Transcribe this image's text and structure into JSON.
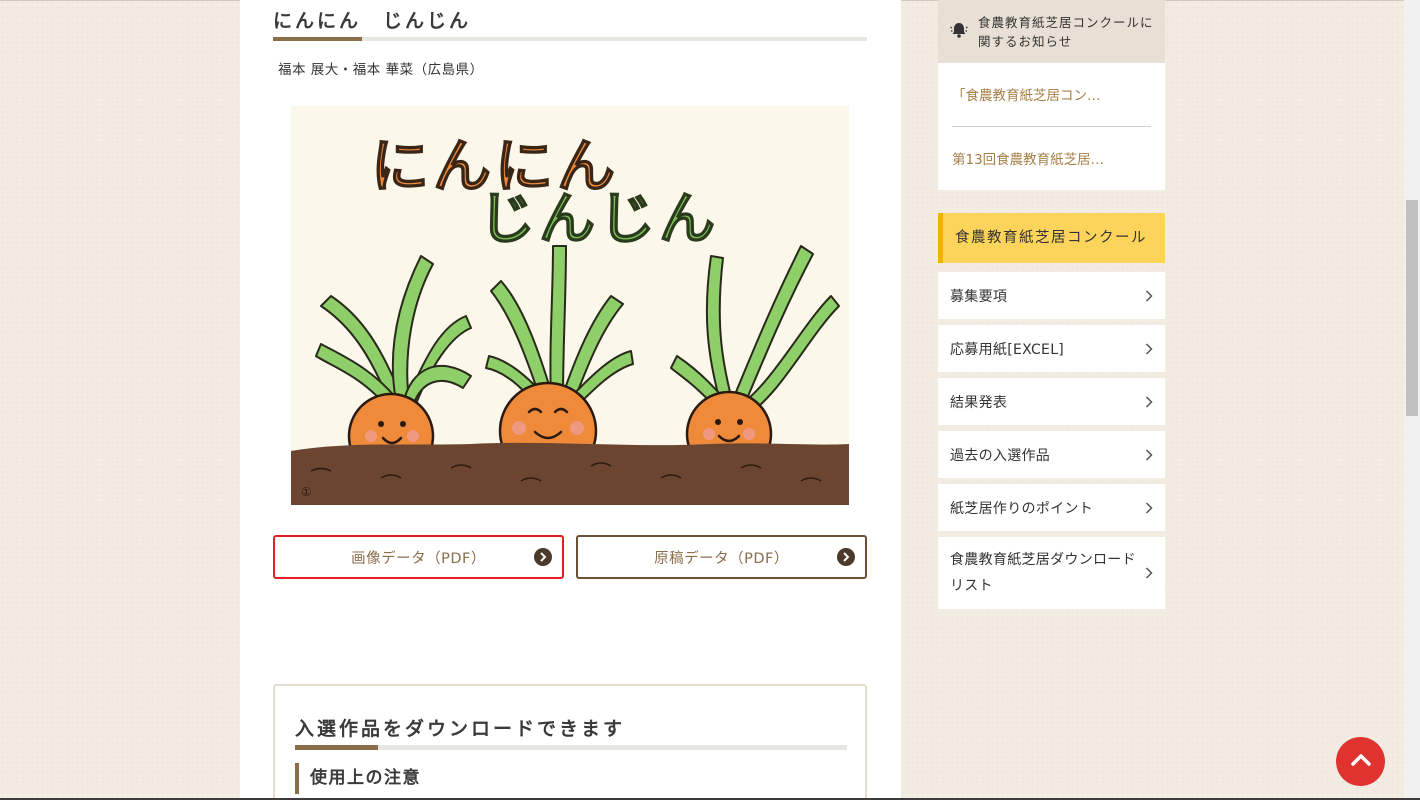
{
  "main": {
    "artwork_title": "にんにん　じんじん",
    "authors": "福本 展大・福本 華菜（広島県）",
    "artwork_text": {
      "line1": "にんにん",
      "line2": "じんじん",
      "page_number": "①"
    },
    "buttons": {
      "image_data": "画像データ（PDF）",
      "draft_data": "原稿データ（PDF）"
    },
    "download_section": {
      "title": "入選作品をダウンロードできます",
      "note_heading": "使用上の注意"
    }
  },
  "sidebar": {
    "notice": {
      "heading": "食農教育紙芝居コンクールに関するお知らせ",
      "links": [
        "「食農教育紙芝居コン…",
        "第13回食農教育紙芝居…"
      ]
    },
    "category": {
      "heading": "食農教育紙芝居コンクール",
      "items": [
        "募集要項",
        "応募用紙[EXCEL]",
        "結果発表",
        "過去の入選作品",
        "紙芝居作りのポイント",
        "食農教育紙芝居ダウンロードリスト"
      ]
    }
  },
  "colors": {
    "accent_brown": "#8a6e4b",
    "link_brown": "#a67f48",
    "category_yellow": "#fcd45c",
    "highlight_red": "#e31e24",
    "to_top_red": "#e0322f"
  },
  "icons": [
    "bell-icon",
    "chevron-right-icon",
    "arrow-circle-icon",
    "chevron-up-icon"
  ]
}
